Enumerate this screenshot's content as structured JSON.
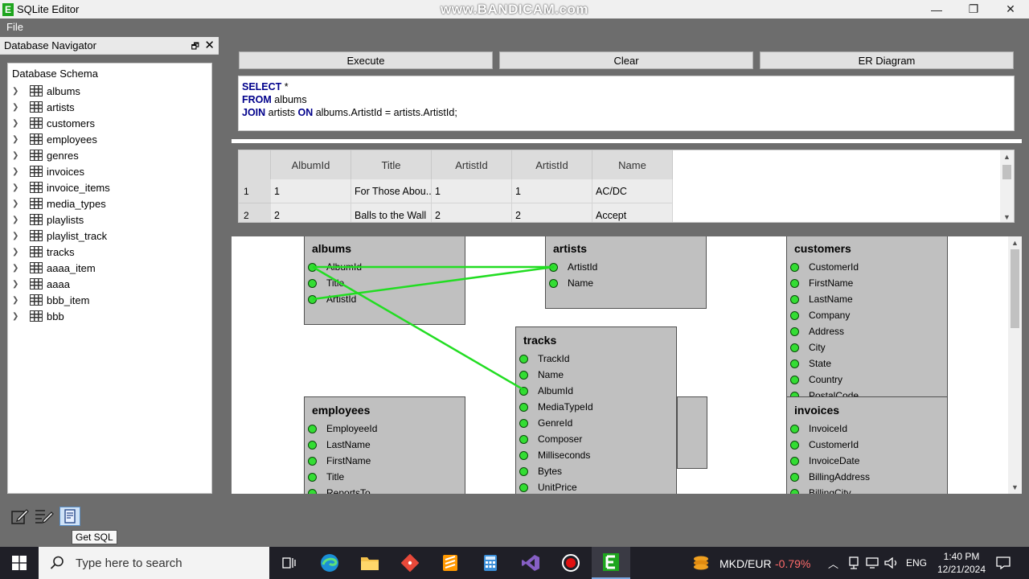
{
  "window": {
    "title": "SQLite Editor",
    "watermark": "www.BANDICAM.com",
    "app_icon_letter": "E",
    "minimize": "—",
    "maximize": "❐",
    "close": "✕"
  },
  "menu": {
    "file": "File"
  },
  "navigator": {
    "title": "Database Navigator",
    "pin": "🗗",
    "close": "✕",
    "root": "Database Schema",
    "tables": [
      "albums",
      "artists",
      "customers",
      "employees",
      "genres",
      "invoices",
      "invoice_items",
      "media_types",
      "playlists",
      "playlist_track",
      "tracks",
      "aaaa_item",
      "aaaa",
      "bbb_item",
      "bbb"
    ]
  },
  "toolbar": {
    "execute": "Execute",
    "clear": "Clear",
    "er_diagram": "ER Diagram"
  },
  "sql": {
    "line1_kw": "SELECT",
    "line1_rest": " *",
    "line2_kw": "FROM",
    "line2_rest": " albums",
    "line3_kw1": "JOIN",
    "line3_mid": " artists ",
    "line3_kw2": "ON",
    "line3_rest": " albums.ArtistId = artists.ArtistId;"
  },
  "results": {
    "columns": [
      "AlbumId",
      "Title",
      "ArtistId",
      "ArtistId",
      "Name"
    ],
    "rows": [
      {
        "num": "1",
        "cells": [
          "1",
          "For Those Abou...",
          "1",
          "1",
          "AC/DC"
        ]
      },
      {
        "num": "2",
        "cells": [
          "2",
          "Balls to the Wall",
          "2",
          "2",
          "Accept"
        ]
      }
    ]
  },
  "er": {
    "albums": {
      "name": "albums",
      "fields": [
        "AlbumId",
        "Title",
        "ArtistId"
      ]
    },
    "artists": {
      "name": "artists",
      "fields": [
        "ArtistId",
        "Name"
      ]
    },
    "customers": {
      "name": "customers",
      "fields": [
        "CustomerId",
        "FirstName",
        "LastName",
        "Company",
        "Address",
        "City",
        "State",
        "Country",
        "PostalCode"
      ]
    },
    "tracks": {
      "name": "tracks",
      "fields": [
        "TrackId",
        "Name",
        "AlbumId",
        "MediaTypeId",
        "GenreId",
        "Composer",
        "Milliseconds",
        "Bytes",
        "UnitPrice"
      ]
    },
    "employees": {
      "name": "employees",
      "fields": [
        "EmployeeId",
        "LastName",
        "FirstName",
        "Title",
        "ReportsTo"
      ]
    },
    "invoices": {
      "name": "invoices",
      "fields": [
        "InvoiceId",
        "CustomerId",
        "InvoiceDate",
        "BillingAddress",
        "BillingCity"
      ]
    },
    "relation_color": "#22dd22"
  },
  "bottom": {
    "tooltip": "Get SQL"
  },
  "taskbar": {
    "search_placeholder": "Type here to search",
    "currency": "MKD/EUR",
    "change": "-0.79%",
    "lang": "ENG",
    "time": "1:40 PM",
    "date": "12/21/2024",
    "change_color": "#ff6b6b"
  }
}
